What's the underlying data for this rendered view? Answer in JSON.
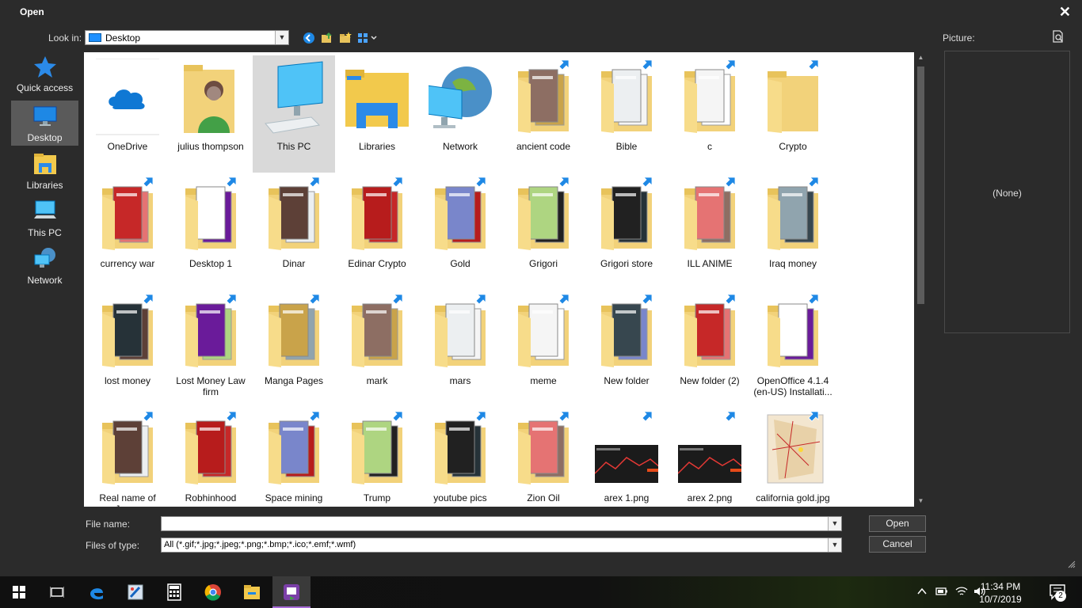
{
  "dialog": {
    "title": "Open",
    "close_glyph": "✕"
  },
  "lookin": {
    "label": "Look in:",
    "value": "Desktop"
  },
  "toolbar": {
    "icons": [
      "back-icon",
      "up-folder-icon",
      "new-folder-icon",
      "view-menu-icon"
    ]
  },
  "places": [
    {
      "label": "Quick access",
      "icon": "star-icon"
    },
    {
      "label": "Desktop",
      "icon": "desktop-icon",
      "selected": true
    },
    {
      "label": "Libraries",
      "icon": "libraries-icon"
    },
    {
      "label": "This PC",
      "icon": "computer-icon"
    },
    {
      "label": "Network",
      "icon": "network-icon"
    }
  ],
  "files": [
    {
      "label": "OneDrive",
      "kind": "onedrive"
    },
    {
      "label": "julius thompson",
      "kind": "user"
    },
    {
      "label": "This PC",
      "kind": "pc",
      "selected": true
    },
    {
      "label": "Libraries",
      "kind": "libraries"
    },
    {
      "label": "Network",
      "kind": "network"
    },
    {
      "label": "ancient code",
      "kind": "folder",
      "shortcut": true
    },
    {
      "label": "Bible",
      "kind": "folder",
      "shortcut": true
    },
    {
      "label": "c",
      "kind": "folder",
      "shortcut": true
    },
    {
      "label": "Crypto",
      "kind": "folder-plain",
      "shortcut": true
    },
    {
      "label": "currency war",
      "kind": "folder",
      "shortcut": true
    },
    {
      "label": "Desktop 1",
      "kind": "folder",
      "shortcut": true
    },
    {
      "label": "Dinar",
      "kind": "folder",
      "shortcut": true
    },
    {
      "label": "Edinar Crypto",
      "kind": "folder",
      "shortcut": true
    },
    {
      "label": "Gold",
      "kind": "folder",
      "shortcut": true
    },
    {
      "label": "Grigori",
      "kind": "folder",
      "shortcut": true
    },
    {
      "label": "Grigori store",
      "kind": "folder",
      "shortcut": true
    },
    {
      "label": "ILL ANIME",
      "kind": "folder",
      "shortcut": true
    },
    {
      "label": "Iraq money",
      "kind": "folder",
      "shortcut": true
    },
    {
      "label": "lost money",
      "kind": "folder",
      "shortcut": true
    },
    {
      "label": "Lost Money Law firm",
      "kind": "folder",
      "shortcut": true
    },
    {
      "label": "Manga Pages",
      "kind": "folder",
      "shortcut": true
    },
    {
      "label": "mark",
      "kind": "folder",
      "shortcut": true
    },
    {
      "label": "mars",
      "kind": "folder",
      "shortcut": true
    },
    {
      "label": "meme",
      "kind": "folder",
      "shortcut": true
    },
    {
      "label": "New folder",
      "kind": "folder",
      "shortcut": true
    },
    {
      "label": "New folder (2)",
      "kind": "folder",
      "shortcut": true
    },
    {
      "label": "OpenOffice 4.1.4 (en-US) Installati...",
      "kind": "folder",
      "shortcut": true
    },
    {
      "label": "Real name of Jesus",
      "kind": "folder",
      "shortcut": true
    },
    {
      "label": "Robhinhood",
      "kind": "folder",
      "shortcut": true
    },
    {
      "label": "Space mining",
      "kind": "folder",
      "shortcut": true
    },
    {
      "label": "Trump",
      "kind": "folder",
      "shortcut": true
    },
    {
      "label": "youtube pics",
      "kind": "folder",
      "shortcut": true
    },
    {
      "label": "Zion Oil",
      "kind": "folder",
      "shortcut": true
    },
    {
      "label": "arex 1.png",
      "kind": "image-dark",
      "shortcut": true
    },
    {
      "label": "arex 2.png",
      "kind": "image-dark",
      "shortcut": true
    },
    {
      "label": "california gold.jpg",
      "kind": "image-map",
      "shortcut": true
    }
  ],
  "filename": {
    "label": "File name:",
    "value": ""
  },
  "filetype": {
    "label": "Files of type:",
    "value": "All (*.gif;*.jpg;*.jpeg;*.png;*.bmp;*.ico;*.emf;*.wmf)"
  },
  "buttons": {
    "open": "Open",
    "cancel": "Cancel"
  },
  "picture": {
    "label": "Picture:",
    "none_text": "(None)"
  },
  "taskbar": {
    "items": [
      "start-icon",
      "task-view-icon",
      "edge-icon",
      "paint-icon",
      "calculator-icon",
      "chrome-icon",
      "file-explorer-icon",
      "app-icon"
    ],
    "active_index": 7,
    "tray": [
      "chevron-up-icon",
      "battery-icon",
      "wifi-icon",
      "volume-icon"
    ],
    "time": "11:34 PM",
    "date": "10/7/2019",
    "notification_count": "2"
  },
  "colors": {
    "accent": "#0078d7",
    "folder": "#f2d27a",
    "shortcut_arrow": "#1e88e5"
  }
}
